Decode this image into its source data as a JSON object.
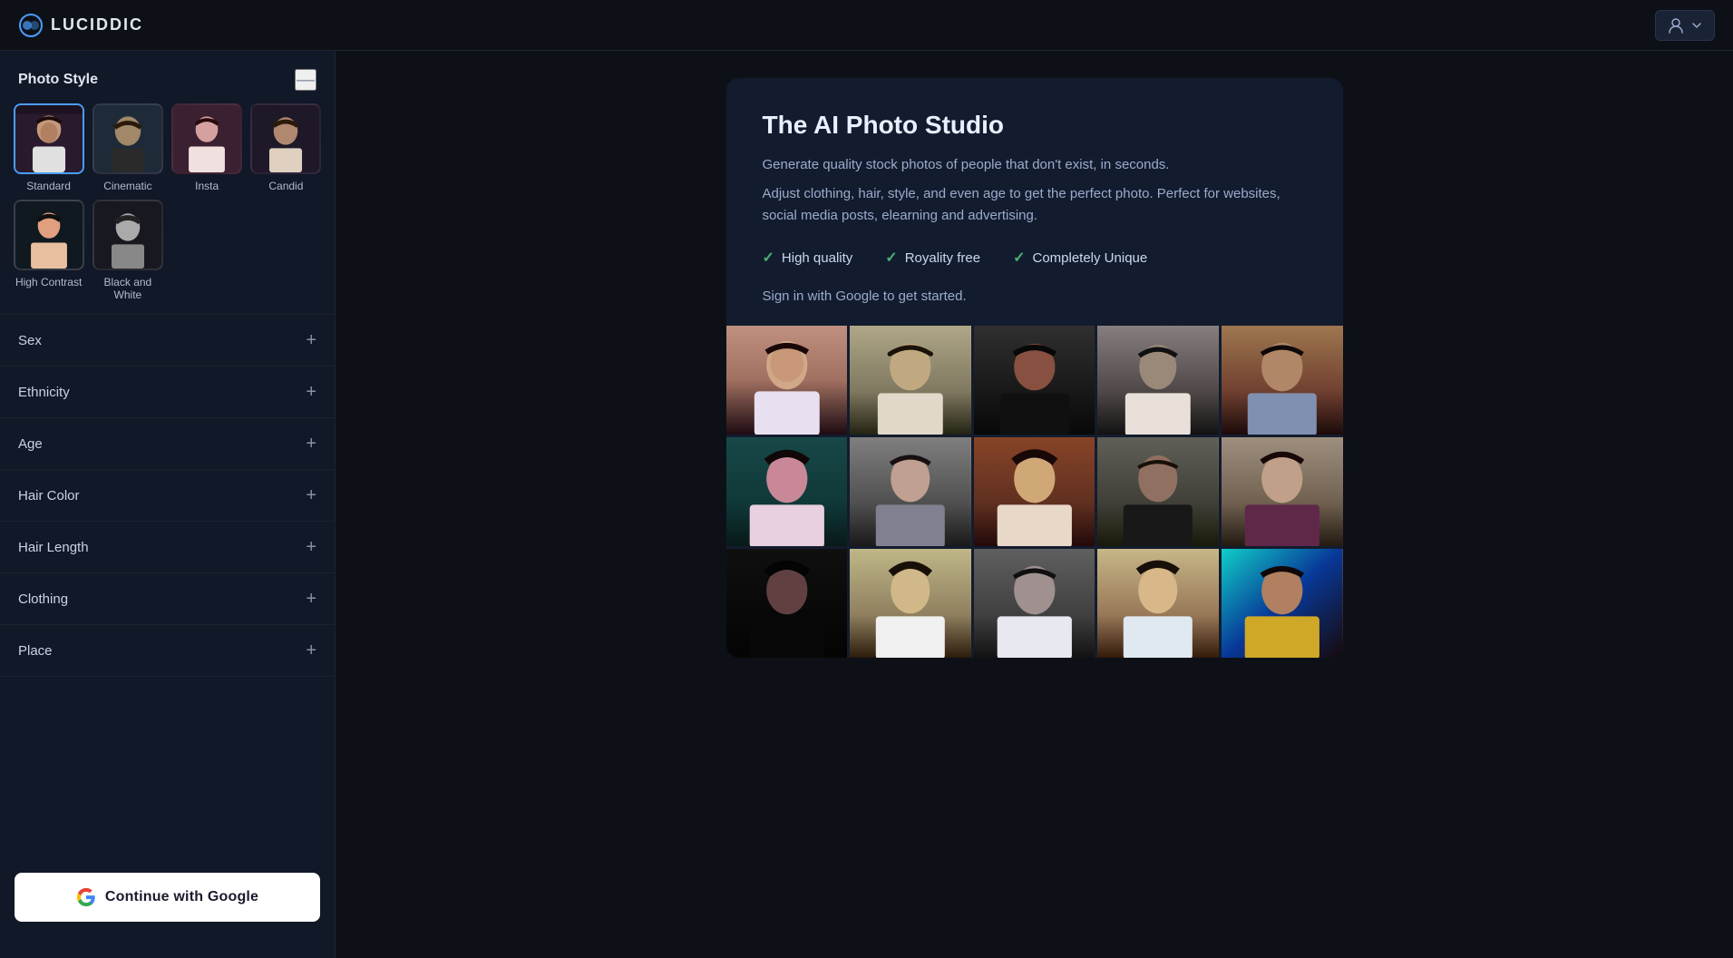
{
  "header": {
    "logo_text": "LUCIDDIC",
    "user_button_label": "▾"
  },
  "sidebar": {
    "photo_style_title": "Photo Style",
    "minimize_icon": "—",
    "styles": [
      {
        "id": "standard",
        "label": "Standard",
        "selected": true,
        "emoji": "👩"
      },
      {
        "id": "cinematic",
        "label": "Cinematic",
        "selected": false,
        "emoji": "👨"
      },
      {
        "id": "insta",
        "label": "Insta",
        "selected": false,
        "emoji": "👩"
      },
      {
        "id": "candid",
        "label": "Candid",
        "selected": false,
        "emoji": "🧔"
      },
      {
        "id": "highcontrast",
        "label": "High Contrast",
        "selected": false,
        "emoji": "👩"
      },
      {
        "id": "bw",
        "label": "Black and White",
        "selected": false,
        "emoji": "🧔"
      }
    ],
    "filters": [
      {
        "id": "sex",
        "label": "Sex"
      },
      {
        "id": "ethnicity",
        "label": "Ethnicity"
      },
      {
        "id": "age",
        "label": "Age"
      },
      {
        "id": "hair_color",
        "label": "Hair Color"
      },
      {
        "id": "hair_length",
        "label": "Hair Length"
      },
      {
        "id": "clothing",
        "label": "Clothing"
      },
      {
        "id": "place",
        "label": "Place"
      }
    ],
    "cta_button": "Continue with Google"
  },
  "main": {
    "card": {
      "title": "The AI Photo Studio",
      "description1": "Generate quality stock photos of people that don't exist, in seconds.",
      "description2": "Adjust clothing, hair, style, and even age to get the perfect photo. Perfect for websites, social media posts, elearning and advertising.",
      "features": [
        {
          "id": "hq",
          "text": "High quality"
        },
        {
          "id": "rf",
          "text": "Royality free"
        },
        {
          "id": "cu",
          "text": "Completely Unique"
        }
      ],
      "sign_in_text": "Sign in with Google to get started.",
      "check_symbol": "✓"
    },
    "photo_grid": {
      "rows": 3,
      "cols": 5,
      "cells": [
        "r1c1",
        "r1c2",
        "r1c3",
        "r1c4",
        "r1c5",
        "r2c1",
        "r2c2",
        "r2c3",
        "r2c4",
        "r2c5",
        "r3c1",
        "r3c2",
        "r3c3",
        "r3c4",
        "r3c5"
      ]
    }
  }
}
